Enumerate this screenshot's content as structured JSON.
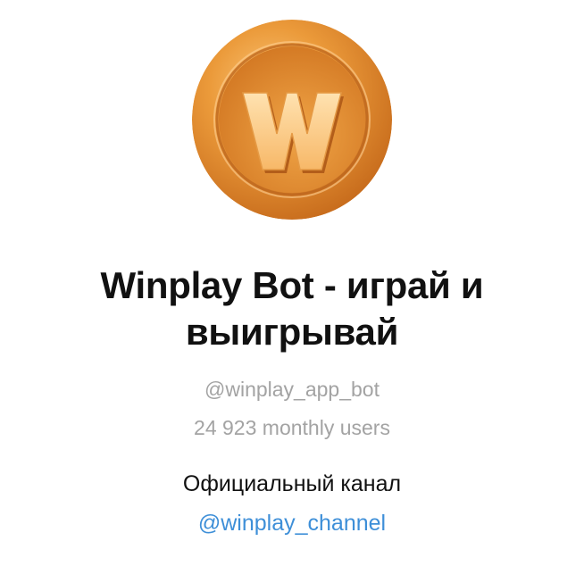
{
  "profile": {
    "avatar_icon": "winplay-coin-logo",
    "avatar_letter": "W",
    "name": "Winplay Bot - играй и выигрывай",
    "username": "@winplay_app_bot",
    "monthly_users": "24 923 monthly users",
    "description": "Официальный канал",
    "channel_link": "@winplay_channel"
  },
  "colors": {
    "coin_light": "#f6b353",
    "coin_mid": "#e38a25",
    "coin_dark": "#c0661a",
    "text": "#111111",
    "muted": "#a3a3a3",
    "link": "#3e8fd8"
  }
}
